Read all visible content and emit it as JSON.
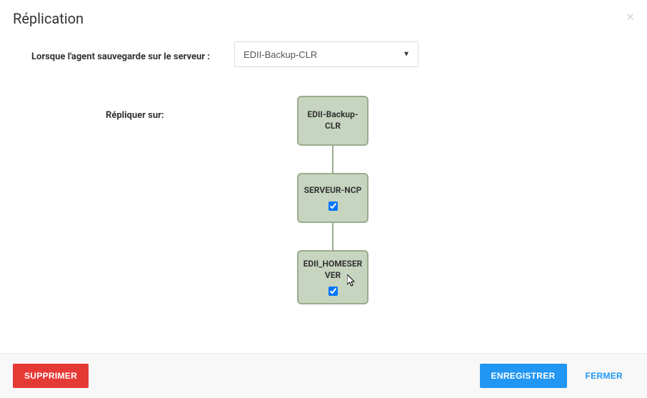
{
  "header": {
    "title": "Réplication"
  },
  "form": {
    "serverLabel": "Lorsque l'agent sauvegarde sur le serveur :",
    "serverValue": "EDII-Backup-CLR",
    "replicateLabel": "Répliquer sur:"
  },
  "nodes": [
    {
      "label": "EDII-Backup-CLR",
      "hasCheckbox": false,
      "checked": false
    },
    {
      "label": "SERVEUR-NCP",
      "hasCheckbox": true,
      "checked": true
    },
    {
      "label": "EDII_HOMESERVER",
      "hasCheckbox": true,
      "checked": true
    }
  ],
  "footer": {
    "delete": "SUPPRIMER",
    "save": "ENREGISTRER",
    "close": "FERMER"
  }
}
